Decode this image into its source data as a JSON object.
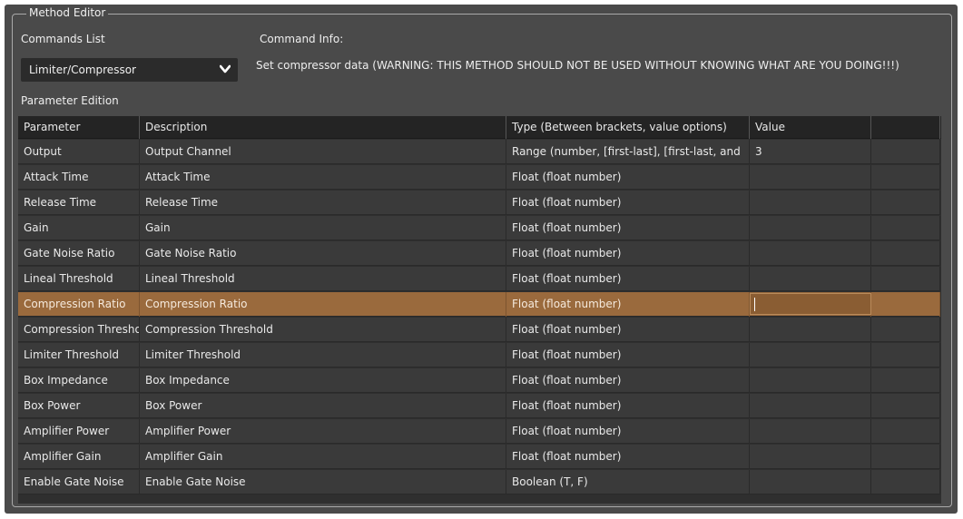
{
  "groupbox": {
    "title": "Method Editor"
  },
  "commands": {
    "label": "Commands List",
    "selected": "Limiter/Compressor"
  },
  "info": {
    "label": "Command Info:",
    "text": "Set compressor data (WARNING: THIS METHOD SHOULD NOT BE USED WITHOUT KNOWING WHAT ARE YOU DOING!!!)"
  },
  "parameters": {
    "label": "Parameter Edition",
    "columns": [
      "Parameter",
      "Description",
      "Type (Between brackets, value options)",
      "Value"
    ],
    "rows": [
      {
        "parameter": "Output",
        "description": "Output Channel",
        "type": "Range (number, [first-last], [first-last, and",
        "value": "3"
      },
      {
        "parameter": "Attack Time",
        "description": "Attack Time",
        "type": "Float (float number)",
        "value": ""
      },
      {
        "parameter": "Release Time",
        "description": "Release Time",
        "type": "Float (float number)",
        "value": ""
      },
      {
        "parameter": "Gain",
        "description": "Gain",
        "type": "Float (float number)",
        "value": ""
      },
      {
        "parameter": "Gate Noise Ratio",
        "description": "Gate Noise Ratio",
        "type": "Float (float number)",
        "value": ""
      },
      {
        "parameter": "Lineal Threshold",
        "description": "Lineal Threshold",
        "type": "Float (float number)",
        "value": ""
      },
      {
        "parameter": "Compression Ratio",
        "description": "Compression Ratio",
        "type": "Float (float number)",
        "value": ""
      },
      {
        "parameter": "Compression Threshold",
        "description": "Compression Threshold",
        "type": "Float (float number)",
        "value": ""
      },
      {
        "parameter": "Limiter Threshold",
        "description": "Limiter Threshold",
        "type": "Float (float number)",
        "value": ""
      },
      {
        "parameter": "Box Impedance",
        "description": "Box Impedance",
        "type": "Float (float number)",
        "value": ""
      },
      {
        "parameter": "Box Power",
        "description": "Box Power",
        "type": "Float (float number)",
        "value": ""
      },
      {
        "parameter": "Amplifier Power",
        "description": "Amplifier Power",
        "type": "Float (float number)",
        "value": ""
      },
      {
        "parameter": "Amplifier Gain",
        "description": "Amplifier Gain",
        "type": "Float (float number)",
        "value": ""
      },
      {
        "parameter": "Enable Gate Noise",
        "description": "Enable Gate Noise",
        "type": "Boolean (T, F)",
        "value": ""
      }
    ],
    "selected_row": 6
  },
  "icons": {
    "combo": "chevron-down-icon",
    "scroll_up": "triangle-up-icon",
    "scroll_down": "triangle-down-icon"
  },
  "colors": {
    "background": "#4a4a4a",
    "grid": "#3a3a3a",
    "header": "#242424",
    "selection": "#9a6a3d",
    "scroll_thumb": "#2ab3dc"
  }
}
